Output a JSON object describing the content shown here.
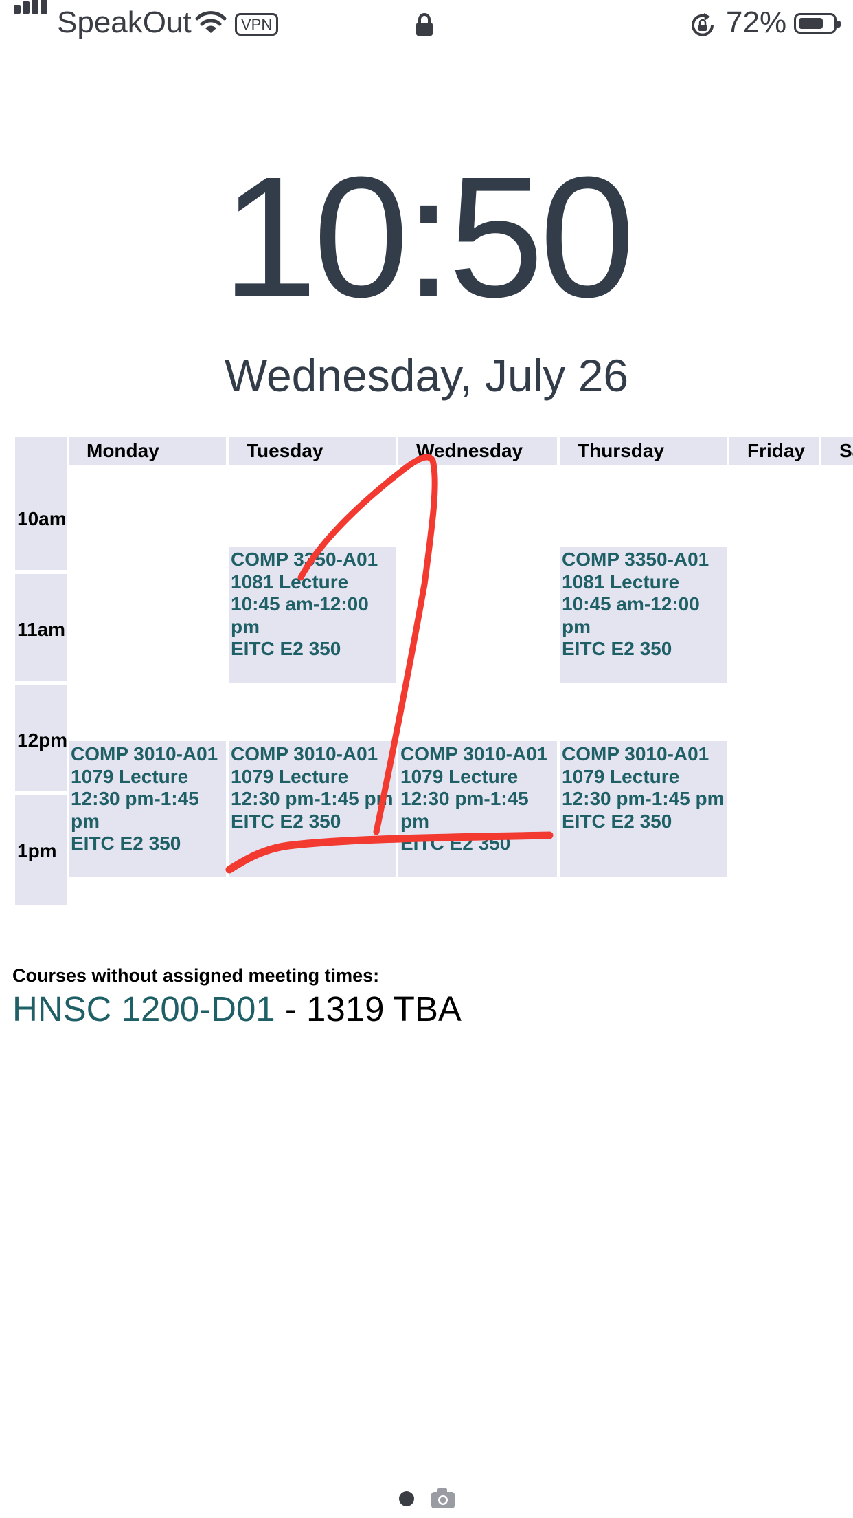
{
  "status_bar": {
    "carrier": "SpeakOut",
    "vpn_label": "VPN",
    "battery_percent": "72%",
    "battery_level": 0.72,
    "icons": [
      "signal-icon",
      "wifi-icon",
      "lock-icon",
      "rotation-lock-icon",
      "battery-icon"
    ]
  },
  "lock_screen": {
    "time": "10:50",
    "date": "Wednesday, July 26"
  },
  "schedule": {
    "days": [
      "Monday",
      "Tuesday",
      "Wednesday",
      "Thursday",
      "Friday",
      "Sa"
    ],
    "times": [
      "10am",
      "11am",
      "12pm",
      "1pm"
    ],
    "events": [
      {
        "day": "Tuesday",
        "lines": [
          "COMP 3350-A01",
          "1081 Lecture",
          "10:45 am-12:00 pm",
          "EITC E2 350"
        ]
      },
      {
        "day": "Thursday",
        "lines": [
          "COMP 3350-A01",
          "1081 Lecture",
          "10:45 am-12:00 pm",
          "EITC E2 350"
        ]
      },
      {
        "day": "Monday",
        "lines": [
          "COMP 3010-A01",
          "1079 Lecture",
          "12:30 pm-1:45 pm",
          "EITC E2 350"
        ]
      },
      {
        "day": "Tuesday",
        "lines": [
          "COMP 3010-A01",
          "1079 Lecture",
          "12:30 pm-1:45 pm",
          "EITC E2 350"
        ]
      },
      {
        "day": "Wednesday",
        "lines": [
          "COMP 3010-A01",
          "1079 Lecture",
          "12:30 pm-1:45 pm",
          "EITC E2 350"
        ]
      },
      {
        "day": "Thursday",
        "lines": [
          "COMP 3010-A01",
          "1079 Lecture",
          "12:30 pm-1:45 pm",
          "EITC E2 350"
        ]
      }
    ]
  },
  "no_meeting": {
    "label": "Courses without assigned meeting times:",
    "course": "HNSC 1200-D01",
    "detail": " - 1319 TBA"
  },
  "colors": {
    "accent_teal": "#1f5f66",
    "cell_background": "#e4e4f0",
    "annotation_red": "#f23a30"
  }
}
